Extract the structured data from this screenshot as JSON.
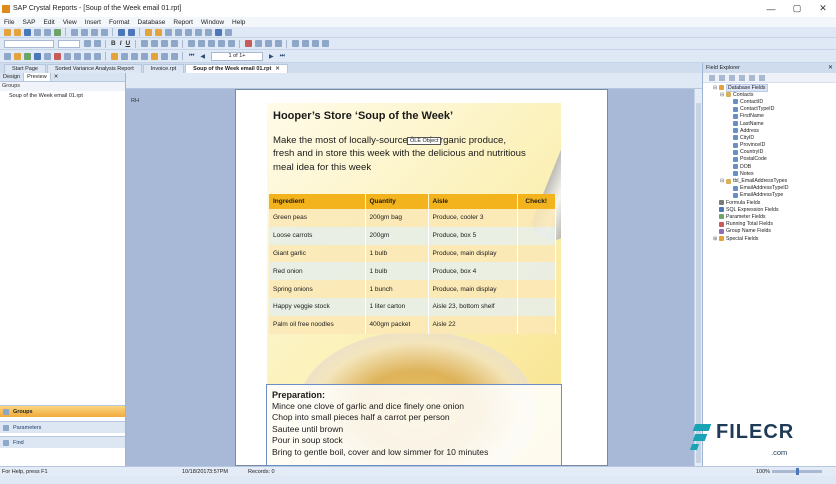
{
  "window": {
    "title": "SAP Crystal Reports - [Soup of the Week email 01.rpt]",
    "buttons": [
      "—",
      "▢",
      "✕"
    ]
  },
  "menu": [
    "File",
    "SAP",
    "Edit",
    "View",
    "Insert",
    "Format",
    "Database",
    "Report",
    "Window",
    "Help"
  ],
  "toolbar": {
    "page_indicator": "1 of 1+",
    "bold": "B",
    "italic": "I",
    "underline": "U"
  },
  "doc_tabs": [
    {
      "label": "Start Page"
    },
    {
      "label": "Sorted Variance Analysis Report"
    },
    {
      "label": "Invoice.rpt"
    },
    {
      "label": "Soup of the Week email 01.rpt",
      "active": true,
      "close": "✕"
    }
  ],
  "left_panel": {
    "tabs": [
      "Design",
      "Preview",
      "✕"
    ],
    "header": "Groups",
    "items": [
      "Soup of the Week email 01.rpt"
    ],
    "bottom": [
      "Groups",
      "Parameters",
      "Find"
    ]
  },
  "canvas": {
    "section_label": "RH",
    "ole_label": "OLE Object"
  },
  "report": {
    "title": "Hooper’s Store ‘Soup of the Week’",
    "subtitle": "Make the most of locally-sourced and organic produce, fresh and in store this week with the delicious and nutritious meal idea for this week",
    "table": {
      "headers": [
        "Ingredient",
        "Quantity",
        "Aisle",
        "Check!"
      ],
      "rows": [
        [
          "Green peas",
          "200gm bag",
          "Produce, cooler 3",
          ""
        ],
        [
          "Loose carrots",
          "200gm",
          "Produce, box 5",
          ""
        ],
        [
          "Giant garlic",
          "1 bulb",
          "Produce, main display",
          ""
        ],
        [
          "Red onion",
          "1 bulb",
          "Produce, box 4",
          ""
        ],
        [
          "Spring onions",
          "1 bunch",
          "Produce, main display",
          ""
        ],
        [
          "Happy veggie stock",
          "1 liter carton",
          "Aisle 23, bottom shelf",
          ""
        ],
        [
          "Palm oil free noodles",
          "400gm packet",
          "Aisle 22",
          ""
        ]
      ]
    },
    "preparation": {
      "title": "Preparation:",
      "steps": [
        "Mince one clove of garlic and dice finely one onion",
        "Chop into small pieces half a carrot per person",
        "Sautee until brown",
        "Pour in soup stock",
        "Bring to gentle boil, cover and low simmer for 10 minutes"
      ]
    }
  },
  "field_explorer": {
    "title": "Field Explorer",
    "pin": "✕",
    "tree": [
      {
        "label": "Database Fields",
        "level": 0,
        "exp": "⊟",
        "icon": "folder",
        "highlight": true
      },
      {
        "label": "Contacts",
        "level": 1,
        "exp": "⊟",
        "icon": "table"
      },
      {
        "label": "ContactID",
        "level": 2,
        "icon": "field"
      },
      {
        "label": "ContactTypeID",
        "level": 2,
        "icon": "field"
      },
      {
        "label": "FirstName",
        "level": 2,
        "icon": "field"
      },
      {
        "label": "LastName",
        "level": 2,
        "icon": "field"
      },
      {
        "label": "Address",
        "level": 2,
        "icon": "field"
      },
      {
        "label": "CityID",
        "level": 2,
        "icon": "field"
      },
      {
        "label": "ProvinceID",
        "level": 2,
        "icon": "field"
      },
      {
        "label": "CountryID",
        "level": 2,
        "icon": "field"
      },
      {
        "label": "PostalCode",
        "level": 2,
        "icon": "field"
      },
      {
        "label": "DOB",
        "level": 2,
        "icon": "field"
      },
      {
        "label": "Notes",
        "level": 2,
        "icon": "field"
      },
      {
        "label": "tbl_EmailAddressTypes",
        "level": 1,
        "exp": "⊟",
        "icon": "table"
      },
      {
        "label": "EmailAddressTypeID",
        "level": 2,
        "icon": "field"
      },
      {
        "label": "EmailAddressType",
        "level": 2,
        "icon": "field"
      },
      {
        "label": "Formula Fields",
        "level": 0,
        "icon": "formula"
      },
      {
        "label": "SQL Expression Fields",
        "level": 0,
        "icon": "sql"
      },
      {
        "label": "Parameter Fields",
        "level": 0,
        "icon": "param"
      },
      {
        "label": "Running Total Fields",
        "level": 0,
        "icon": "total"
      },
      {
        "label": "Group Name Fields",
        "level": 0,
        "icon": "group"
      },
      {
        "label": "Special Fields",
        "level": 0,
        "exp": "⊞",
        "icon": "special"
      }
    ]
  },
  "status": {
    "help": "For Help, press F1",
    "date": "10/18/2017",
    "time": "3:57PM",
    "records": "Records: 0",
    "zoom": "100%"
  },
  "watermark": {
    "brand": "FILECR",
    "domain": ".com"
  }
}
